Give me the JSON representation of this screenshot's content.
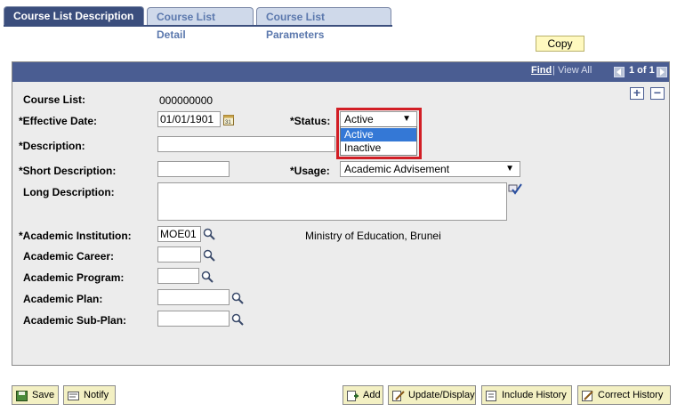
{
  "tabs": [
    {
      "label": "Course List Description"
    },
    {
      "label": "Course List Detail"
    },
    {
      "label": "Course List Parameters"
    }
  ],
  "toolbar": {
    "copy_label": "Copy"
  },
  "nav": {
    "find": "Find",
    "sep": "|",
    "view_all": "View All",
    "page_count": "1 of 1"
  },
  "form": {
    "course_list_label": "Course List:",
    "course_list_value": "000000000",
    "effective_date_label": "*Effective Date:",
    "effective_date_value": "01/01/1901",
    "status_label": "*Status:",
    "status_value": "Active",
    "status_options": [
      "Active",
      "Inactive"
    ],
    "description_label": "*Description:",
    "description_value": "",
    "short_description_label": "*Short Description:",
    "short_description_value": "",
    "usage_label": "*Usage:",
    "usage_value": "Academic Advisement",
    "long_description_label": "Long Description:",
    "long_description_value": "",
    "institution_label": "*Academic Institution:",
    "institution_value": "MOE01",
    "institution_desc": "Ministry of Education, Brunei",
    "career_label": "Academic Career:",
    "program_label": "Academic Program:",
    "plan_label": "Academic Plan:",
    "subplan_label": "Academic Sub-Plan:"
  },
  "buttons": {
    "save": "Save",
    "notify": "Notify",
    "add": "Add",
    "update_display": "Update/Display",
    "include_history": "Include History",
    "correct_history": "Correct History"
  },
  "colors": {
    "header": "#4a5d92",
    "tab_active": "#3b4e7d",
    "highlight": "#d21e25",
    "selected_option": "#3478d6"
  },
  "icons": [
    "calendar-icon",
    "spellcheck-icon",
    "search-icon",
    "save-icon",
    "notify-icon",
    "add-icon",
    "update-display-icon",
    "include-history-icon",
    "correct-history-icon"
  ]
}
